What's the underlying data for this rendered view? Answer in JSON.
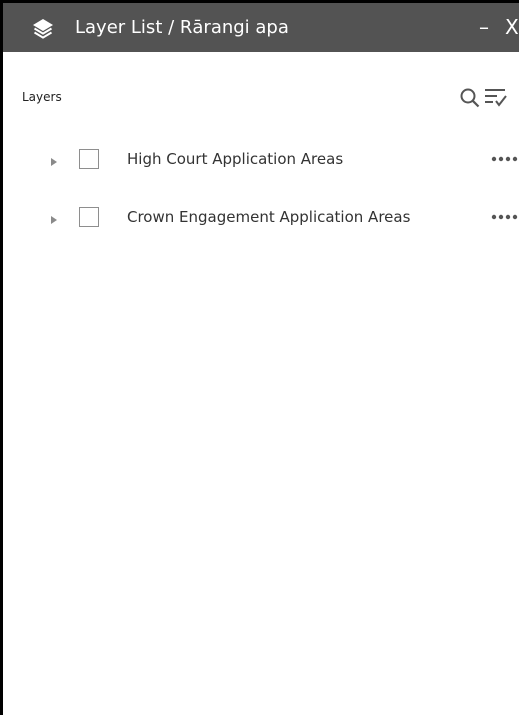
{
  "panel": {
    "title": "Layer List / Rārangi apa",
    "minimize_label": "–",
    "close_label": "X",
    "icons": {
      "title": "layers-icon",
      "minimize": "minimize-icon",
      "close": "close-icon",
      "search": "search-icon",
      "filter": "filter-list-icon",
      "expand": "caret-right-icon",
      "more": "more-options-icon"
    },
    "colors": {
      "titlebar_background": "#535353",
      "titlebar_text": "#ffffff",
      "panel_background": "#ffffff",
      "border": "#000000"
    }
  },
  "layers_section": {
    "label": "Layers",
    "items": [
      {
        "name": "High Court Application Areas",
        "checked": false
      },
      {
        "name": "Crown Engagement Application Areas",
        "checked": false
      }
    ]
  }
}
